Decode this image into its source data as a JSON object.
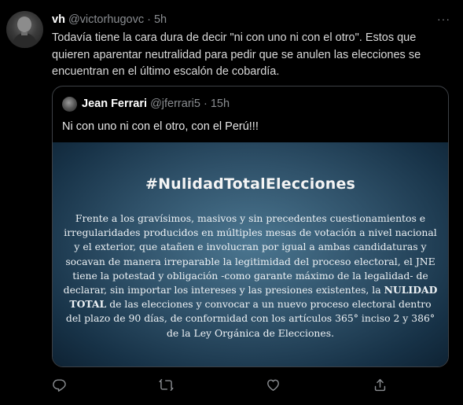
{
  "tweet": {
    "name": "vh",
    "handle": "@victorhugovc",
    "separator": "·",
    "time": "5h",
    "more_label": "···",
    "text": "Todavía tiene la cara dura de decir \"ni con uno ni con el otro\". Estos que quieren aparentar neutralidad para pedir que se anulen las elecciones se encuentran en el último escalón de cobardía."
  },
  "quote": {
    "name": "Jean Ferrari",
    "handle": "@jferrari5",
    "separator": "·",
    "time": "15h",
    "text": "Ni con uno ni con el otro, con el Perú!!!",
    "image": {
      "title": "#NulidadTotalElecciones",
      "paragraph_before": "Frente a los gravísimos, masivos y sin precedentes cuestionamientos e irregularidades producidos en múltiples mesas de votación a nivel nacional y el exterior, que atañen e involucran por igual a ambas candidaturas y socavan de manera irreparable la legitimidad del proceso electoral, el JNE tiene la potestad y obligación -como garante máximo de la legalidad- de declarar, sin importar los intereses y las presiones existentes, la ",
      "paragraph_bold": "NULIDAD TOTAL",
      "paragraph_after": " de las elecciones y convocar a un nuevo proceso electoral dentro del plazo de 90 días, de conformidad con los artículos 365° inciso 2 y 386° de la Ley Orgánica de Elecciones."
    }
  },
  "actions": [
    {
      "name": "reply",
      "icon": "reply-icon"
    },
    {
      "name": "retweet",
      "icon": "retweet-icon"
    },
    {
      "name": "like",
      "icon": "heart-icon"
    },
    {
      "name": "share",
      "icon": "share-icon"
    }
  ],
  "colors": {
    "background": "#000000",
    "text": "#d9d9d9",
    "muted": "#8a8d91",
    "border": "#3d4146",
    "image_bg": "#2f5169"
  }
}
